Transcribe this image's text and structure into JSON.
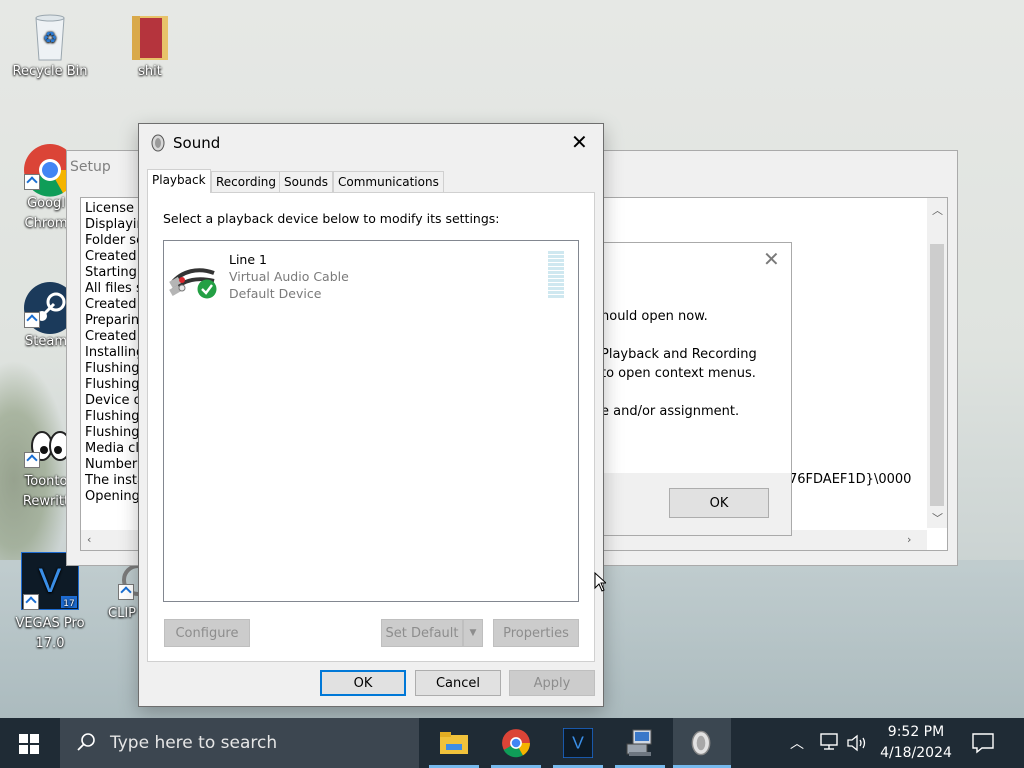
{
  "desktop": {
    "icons": [
      {
        "label": "Recycle Bin",
        "icon": "recycle-bin-icon"
      },
      {
        "label": "shit",
        "icon": "folder-icon"
      },
      {
        "label": "Googl Chrom",
        "icon": "chrome-icon"
      },
      {
        "label": "Steam",
        "icon": "steam-icon"
      },
      {
        "label": "Toonto Rewritt",
        "icon": "toontown-icon"
      },
      {
        "label": "VEGAS Pro 17.0",
        "icon": "vegas-pro-icon"
      },
      {
        "label": "CLIP",
        "icon": "clip-icon"
      }
    ]
  },
  "setup_window": {
    "title": "Setup",
    "lines": [
      "License a",
      "Displaying",
      "Folder sel",
      "Created d",
      "Starting fi",
      "All files su",
      "Created d",
      "Preparing",
      "Created d",
      "Installing",
      "Flushing r",
      "Flushing v",
      "Device dri",
      "Flushing r",
      "Flushing v",
      "Media cla",
      "Number o",
      "The instal",
      "Opening a"
    ],
    "trailing_text": "76FDAEF1D}\\0000"
  },
  "message_dialog": {
    "lines": [
      "hould open now.",
      "Playback and Recording",
      "to open context menus.",
      "e and/or assignment."
    ],
    "ok_label": "OK"
  },
  "sound_dialog": {
    "title": "Sound",
    "tabs": [
      {
        "label": "Playback",
        "active": true
      },
      {
        "label": "Recording",
        "active": false
      },
      {
        "label": "Sounds",
        "active": false
      },
      {
        "label": "Communications",
        "active": false
      }
    ],
    "instruction": "Select a playback device below to modify its settings:",
    "devices": [
      {
        "name": "Line 1",
        "description": "Virtual Audio Cable",
        "status": "Default Device"
      }
    ],
    "buttons": {
      "configure": "Configure",
      "set_default": "Set Default",
      "properties": "Properties",
      "ok": "OK",
      "cancel": "Cancel",
      "apply": "Apply"
    }
  },
  "taskbar": {
    "search_placeholder": "Type here to search",
    "time": "9:52 PM",
    "date": "4/18/2024"
  },
  "colors": {
    "accent": "#0078d7",
    "taskbar_bg": "#1f2b35",
    "search_bg": "#3c4650",
    "check_green": "#23a044"
  }
}
